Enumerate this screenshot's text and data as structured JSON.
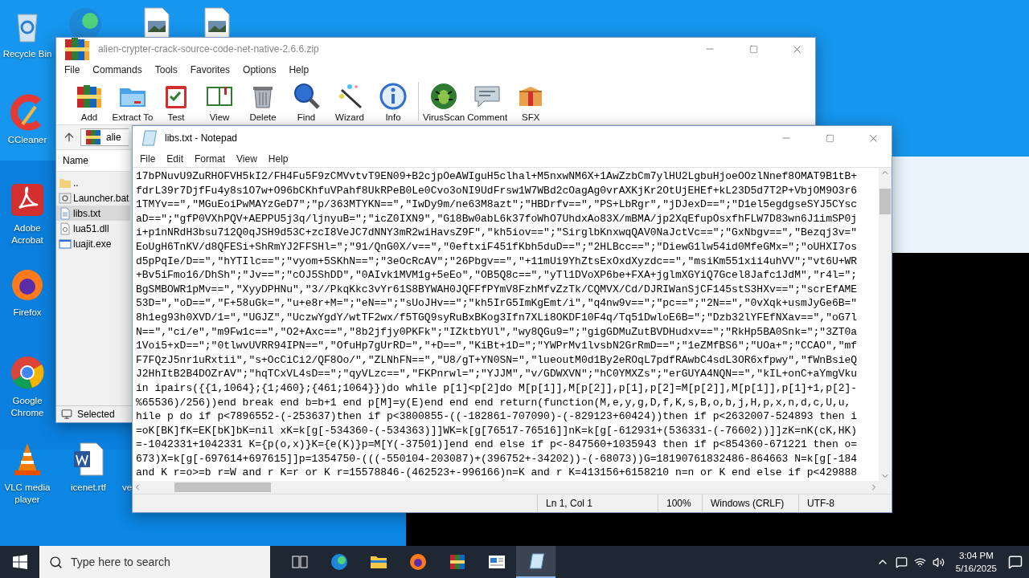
{
  "desktop_icons": [
    {
      "kind": "recycle",
      "label": "Recycle Bin"
    },
    {
      "kind": "edge"
    },
    {
      "kind": "image-file"
    },
    {
      "kind": "image-file"
    },
    {
      "kind": "ccleaner",
      "label": "CCleaner"
    },
    {
      "kind": "acrobat",
      "label": "Adobe Acrobat"
    },
    {
      "kind": "firefox",
      "label": "Firefox"
    },
    {
      "kind": "chrome",
      "label": "Google Chrome"
    },
    {
      "kind": "vlc",
      "label": "VLC media player"
    },
    {
      "kind": "word",
      "label": "icenet.rtf"
    },
    {
      "label": "ve"
    }
  ],
  "winrar": {
    "title": "alien-crypter-crack-source-code-net-native-2.6.6.zip",
    "menu": [
      "File",
      "Commands",
      "Tools",
      "Favorites",
      "Options",
      "Help"
    ],
    "toolbar": [
      {
        "kind": "add",
        "label": "Add"
      },
      {
        "kind": "extract",
        "label": "Extract To"
      },
      {
        "kind": "test",
        "label": "Test"
      },
      {
        "kind": "view",
        "label": "View"
      },
      {
        "kind": "delete",
        "label": "Delete"
      },
      {
        "kind": "find",
        "label": "Find"
      },
      {
        "kind": "wizard",
        "label": "Wizard"
      },
      {
        "kind": "info",
        "label": "Info"
      },
      {
        "kind": "virusscan",
        "label": "VirusScan"
      },
      {
        "kind": "comment",
        "label": "Comment"
      },
      {
        "kind": "sfx",
        "label": "SFX"
      }
    ],
    "path": "alie",
    "column": "Name",
    "files": [
      {
        "kind": "folder",
        "name": "..",
        "selected": false
      },
      {
        "kind": "bat",
        "name": "Launcher.bat",
        "selected": false
      },
      {
        "kind": "txt",
        "name": "libs.txt",
        "selected": true
      },
      {
        "kind": "dll",
        "name": "lua51.dll",
        "selected": false
      },
      {
        "kind": "exe",
        "name": "luajit.exe",
        "selected": false
      }
    ],
    "status": "Selected"
  },
  "notepad": {
    "title": "libs.txt - Notepad",
    "menu": [
      "File",
      "Edit",
      "Format",
      "View",
      "Help"
    ],
    "lines": [
      "17bPNuvU9ZuRHOFVH5kI2/FH4Fu5F9zCMVvtvT9EN09+B2cjpOeAWIguH5clhal+M5nxwNM6X+1AwZzbCm7ylHU2LgbuHjoeOOzlNnef8OMAT9B1tB+",
      "fdrL39r7DjfFu4y8s1O7w+O96bCKhfuVPahf8UkRPeB0Le0Cvo3oNI9UdFrsw1W7WBd2cOagAg0vrAXKjKr2OtUjEHEf+kL23D5d7T2P+VbjOM9O3r6",
      "1TMYv==\",\"MGuEoiPwMAYzGeD7\";\"p/363MTYKN==\",\"IwDy9m/ne63M8azt\";\"HBDrfv==\",\"PS+LbRgr\",\"jDJexD==\";\"D1el5egdgseSYJ5CYsc",
      "aD==\";\"gfP0VXhPQV+AEPPU5j3q/ljnyuB=\";\"icZ0IXN9\",\"G18Bw0abL6k37foWhO7UhdxAo83X/mBMA/jp2XqEfupOsxfhFLW7D83wn6J1imSP0j",
      "i+p1nNRdH3bsu712Q0qJSH9d53C+zcI8VeJC7dNNY3mR2wiHavsZ9F\",\"kh5iov==\";\"SirglbKnxwqQAV0NaJctVc==\";\"GxNbgv==\",\"Bezqj3v=\"",
      "EoUgH6TnKV/d8QFESi+ShRmYJ2FFSHl=\";\"91/QnG0X/v==\",\"0eftxiF451fKbh5duD==\";\"2HLBcc==\";\"DiewG1lw54id0MfeGMx=\";\"oUHXI7os",
      "d5pPqIe/D==\",\"hYTIlc==\";\"vyom+5SKhN==\";\"3eOcRcAV\";\"26Pbgv==\",\"+11mUi9YhZtsExOxdXyzdc==\",\"msiKm551xii4uhVV\";\"vt6U+WR",
      "+Bv5iFmo16/DhSh\";\"Jv==\";\"cOJ5ShDD\",\"0AIvk1MVM1g+5eEo\",\"OB5Q8c==\",\"yTl1DVoXP6be+FXA+jglmXGYiQ7Gcel8Jafc1JdM\",\"r4l=\";",
      "BgSMBOWR1pMv==\",\"XyyDPHNu\",\"3//PkqKkc3vYr61S8BYWAH0JQFFfPYmV8FzhMfvZzTk/CQMVX/Cd/DJRIWanSjCF145stS3HXv==\";\"scrEfAME",
      "53D=\",\"oD==\",\"F+58uGk=\",\"u+e8r+M=\";\"eN==\";\"sUoJHv==\";\"kh5IrG5ImKgEmt/i\",\"q4nw9v==\";\"pc==\";\"2N==\",\"0vXqk+usmJyGe6B=\"",
      "8h1eg93h0XVD/1=\",\"UGJZ\",\"UczwYgdY/wtTF2wx/f5TGQ9syRuBxBKog3Ifn7XLi8OKDF10F4q/Tq51DwloE6B=\";\"Dzb32lYFEfNXav==\",\"oG7l",
      "N==\",\"ci/e\",\"m9Fw1c==\",\"O2+Axc==\",\"8b2jfjy0PKFk\";\"IZktbYUl\",\"wy8QGu9=\";\"gigGDMuZutBVDHudxv==\";\"RkHp5BA0Snk=\";\"3ZT0a",
      "1Voi5+xD==\";\"0tlwvUVRR94IPN==\",\"OfuHp7gUrRD=\",\"+D==\",\"KiBt+1D=\";\"YWPrMv1lvsbN2GrRmD==\";\"1eZMfBS6\";\"UOa+\";\"CCAO\",\"mf",
      "F7FQzJ5nr1uRxtii\",\"s+OcCiCi2/QF8Oo/\",\"ZLNhFN==\",\"U8/gT+YN0SN=\",\"lueoutM0d1By2eROqL7pdfRAwbC4sdL3OR6xfpwy\",\"fWnBsieQ",
      "J2HhItB2B4DOZrAV\";\"hqTCxVL4sD==\";\"qyVLzc==\",\"FKPnrwl=\";\"YJJM\",\"v/GDWXVN\";\"hC0YMXZs\";\"erGUYA4NQN==\",\"kIL+onC+aYmgVku",
      "in ipairs({{1,1064};{1;460};{461;1064}})do while p[1]<p[2]do M[p[1]],M[p[2]],p[1],p[2]=M[p[2]],M[p[1]],p[1]+1,p[2]-",
      "%65536)/256))end break end b=b+1 end p[M]=y(E)end end end return(function(M,e,y,g,D,f,K,s,B,o,b,j,H,p,x,n,d,c,U,u,",
      "hile p do if p<7896552-(-253637)then if p<3800855-((-182861-707090)-(-829123+60424))then if p<2632007-524893 then i",
      "=oK[BK]fK=EK[bK]bK=nil xK=k[g[-534360-(-534363)]]WK=k[g[76517-76516]]nK=k[g[-612931+(536331-(-76602))]]zK=nK(cK,HK)",
      "=-1042331+1042331 K={p(o,x)}K={e(K)}p=M[Y(-37501)]end end else if p<-847560+1035943 then if p<854360-671221 then o=",
      "673)X=k[g[-697614+697615]]p=1354750-(((-550104-203087)+(396752+-34202))-(-68073))G=18190761832486-864663 N=k[g[-184",
      "and K r=o>=b r=W and r K=r or K r=15578846-(462523+-996166)n=K and r K=413156+6158210 n=n or K end else if p<429888"
    ],
    "status": [
      "Ln 1, Col 1",
      "100%",
      "Windows (CRLF)",
      "UTF-8"
    ]
  },
  "taskbar": {
    "search_placeholder": "Type here to search",
    "apps": [
      {
        "kind": "taskview",
        "active": false
      },
      {
        "kind": "edge",
        "active": false
      },
      {
        "kind": "explorer",
        "active": false
      },
      {
        "kind": "firefox",
        "active": false
      },
      {
        "kind": "winrar",
        "active": false
      },
      {
        "kind": "app",
        "active": false
      },
      {
        "kind": "notepad",
        "active": true
      }
    ],
    "time": "3:04 PM",
    "date": "5/16/2025"
  }
}
